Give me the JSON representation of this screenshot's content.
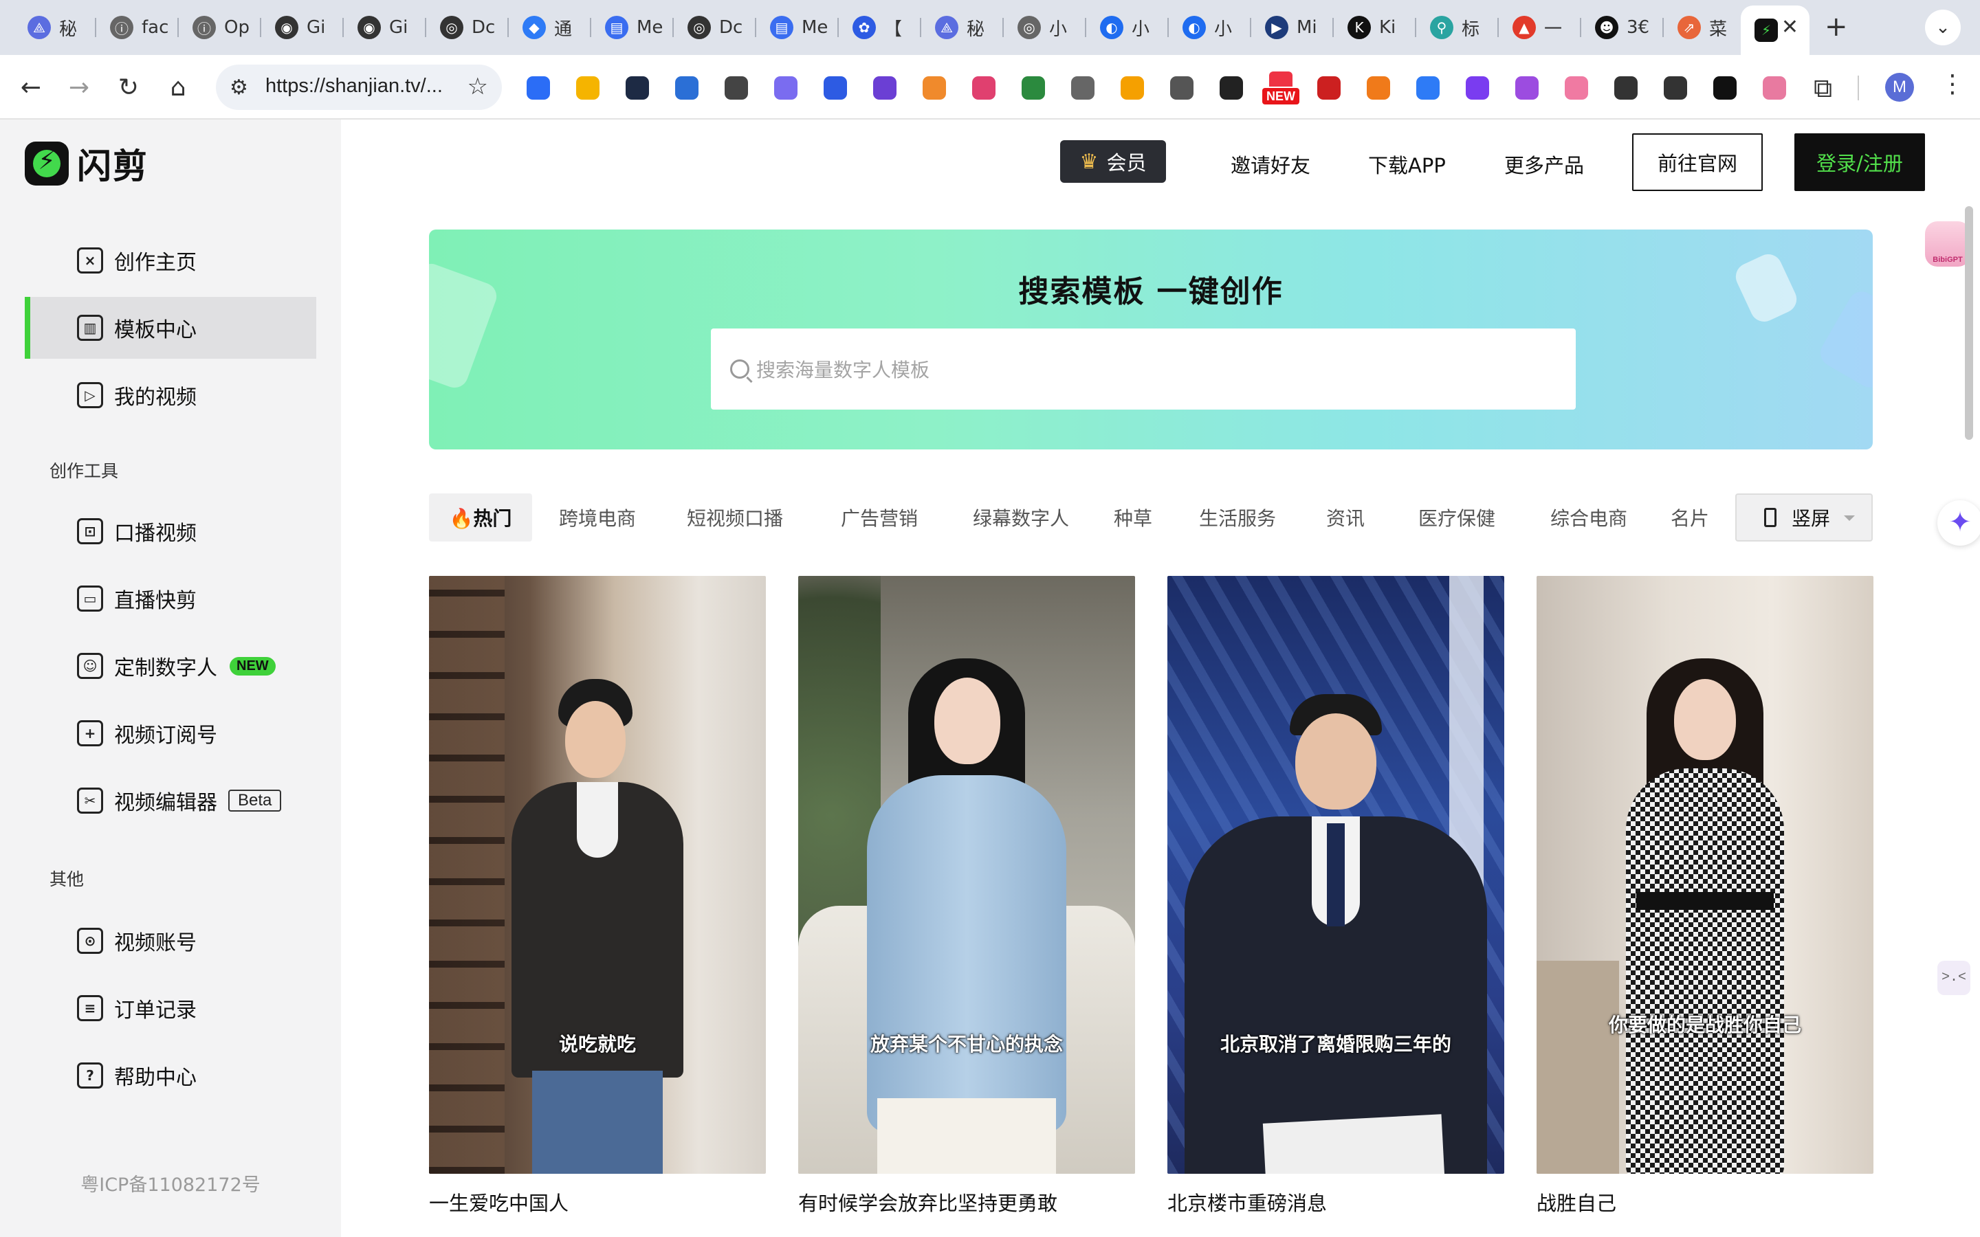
{
  "browser": {
    "tabs": [
      {
        "title": "秘",
        "color": "#5b6de0",
        "glyph": "⟁"
      },
      {
        "title": "fac",
        "color": "#666",
        "glyph": "ⓘ"
      },
      {
        "title": "Op",
        "color": "#666",
        "glyph": "ⓘ"
      },
      {
        "title": "Gi",
        "color": "#333",
        "glyph": "◉"
      },
      {
        "title": "Gi",
        "color": "#333",
        "glyph": "◉"
      },
      {
        "title": "Dc",
        "color": "#333",
        "glyph": "◎"
      },
      {
        "title": "通",
        "color": "#2e7bf6",
        "glyph": "◆"
      },
      {
        "title": "Me",
        "color": "#3a6df0",
        "glyph": "▤"
      },
      {
        "title": "Dc",
        "color": "#333",
        "glyph": "◎"
      },
      {
        "title": "Me",
        "color": "#3a6df0",
        "glyph": "▤"
      },
      {
        "title": "【",
        "color": "#2d5be3",
        "glyph": "✿"
      },
      {
        "title": "秘",
        "color": "#5b6de0",
        "glyph": "⟁"
      },
      {
        "title": "小",
        "color": "#666",
        "glyph": "◎"
      },
      {
        "title": "小",
        "color": "#1f6cf0",
        "glyph": "◐"
      },
      {
        "title": "小",
        "color": "#1f6cf0",
        "glyph": "◐"
      },
      {
        "title": "Mi",
        "color": "#1d3b7a",
        "glyph": "▶"
      },
      {
        "title": "Ki",
        "color": "#111",
        "glyph": "K"
      },
      {
        "title": "标",
        "color": "#2aa4a1",
        "glyph": "⚲"
      },
      {
        "title": "一",
        "color": "#e23a2a",
        "glyph": "▲"
      },
      {
        "title": "3€",
        "color": "#111",
        "glyph": "☻"
      },
      {
        "title": "菜",
        "color": "#e8663a",
        "glyph": "⇗"
      }
    ],
    "active_tab": {
      "glyph": "⚡",
      "color": "#111"
    },
    "url": "https://shanjian.tv/...",
    "extensions": [
      "#2b6df6",
      "#f5b400",
      "#1d2a44",
      "#2b6fd6",
      "#444",
      "#7a6cf0",
      "#2d5be3",
      "#6b3fd4",
      "#f08a2c",
      "#e0406f",
      "#2b8a3e",
      "#666",
      "#f5a000",
      "#555",
      "#222",
      "#cc2020",
      "#f07a1a",
      "#2e7bf6",
      "#7a3cf0",
      "#9c4ce0",
      "#f07aa2",
      "#333",
      "#333",
      "#111",
      "#e87aa0"
    ],
    "profile_initial": "M"
  },
  "logo": {
    "name": "闪剪",
    "mark": "⚡"
  },
  "sidebar": {
    "main_items": [
      {
        "label": "创作主页",
        "icon": "×",
        "active": false
      },
      {
        "label": "模板中心",
        "icon": "▥",
        "active": true
      },
      {
        "label": "我的视频",
        "icon": "▷",
        "active": false
      }
    ],
    "section_tools": "创作工具",
    "tool_items": [
      {
        "label": "口播视频",
        "icon": "⊡",
        "badge": ""
      },
      {
        "label": "直播快剪",
        "icon": "▭",
        "badge": ""
      },
      {
        "label": "定制数字人",
        "icon": "☺",
        "badge": "NEW"
      },
      {
        "label": "视频订阅号",
        "icon": "+",
        "badge": ""
      },
      {
        "label": "视频编辑器",
        "icon": "✂",
        "badge": "Beta"
      }
    ],
    "section_other": "其他",
    "other_items": [
      {
        "label": "视频账号",
        "icon": "⊙"
      },
      {
        "label": "订单记录",
        "icon": "≡"
      },
      {
        "label": "帮助中心",
        "icon": "?"
      }
    ],
    "icp": "粤ICP备11082172号"
  },
  "topnav": {
    "vip": "会员",
    "invite": "邀请好友",
    "download": "下载APP",
    "more": "更多产品",
    "official": "前往官网",
    "login": "登录/注册"
  },
  "banner": {
    "title": "搜索模板 一键创作",
    "search_placeholder": "搜索海量数字人模板"
  },
  "categories": [
    "🔥热门",
    "跨境电商",
    "短视频口播",
    "广告营销",
    "绿幕数字人",
    "种草",
    "生活服务",
    "资讯",
    "医疗保健",
    "综合电商",
    "名片"
  ],
  "orientation": "竖屏",
  "templates": [
    {
      "caption": "说吃就吃",
      "title": "一生爱吃中国人"
    },
    {
      "caption": "放弃某个不甘心的执念",
      "title": "有时候学会放弃比坚持更勇敢"
    },
    {
      "caption": "北京取消了离婚限购三年的",
      "title": "北京楼市重磅消息"
    },
    {
      "caption": "你要做的是战胜你自己",
      "title": "战胜自己"
    }
  ],
  "widgets": {
    "bibigpt": "BibiGPT",
    "mini": ">.<"
  }
}
